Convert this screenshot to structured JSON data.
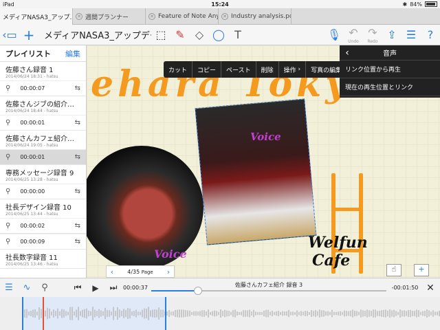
{
  "status": {
    "carrier": "iPad",
    "time": "15:24",
    "battery": "84%",
    "battery_level": 0.84
  },
  "tabs": [
    {
      "label": "メディアNASA3_アップ…",
      "active": true
    },
    {
      "label": "週間プランナー",
      "active": false
    },
    {
      "label": "Feature of Note Anyt…",
      "active": false
    },
    {
      "label": "Industry analysis.pdf",
      "active": false
    }
  ],
  "toolbar": {
    "doc_title": "メディアNASA3_アップデート…",
    "undo_label": "Undo",
    "redo_label": "Redo"
  },
  "sidebar": {
    "title": "プレイリスト",
    "edit_label": "編集",
    "items": [
      {
        "title": "佐藤さん録音 1",
        "date": "2014/06/24 18:31 - hatsu",
        "clip": "00:00:07",
        "active": false
      },
      {
        "title": "佐藤さんジブの紹介…",
        "date": "2014/06/24 18:44 - hatsu",
        "clip": "00:00:01",
        "active": false
      },
      {
        "title": "佐藤さんカフェ紹介…",
        "date": "2014/06/24 19:05 - hatsu",
        "clip": "00:00:01",
        "active": true
      },
      {
        "title": "専務メッセージ録音 9",
        "date": "2014/06/25 13:28 - hatsu",
        "clip": "00:00:00",
        "active": false
      },
      {
        "title": "社長デザイン録音 10",
        "date": "2014/06/25 13:44 - hatsu",
        "clip": "00:00:02",
        "active": false
      },
      {
        "title": "",
        "date": "",
        "clip": "00:00:09",
        "active": false
      },
      {
        "title": "社長数字録音 11",
        "date": "2014/06/25 13:46 - hatsu",
        "clip": "",
        "active": false
      }
    ]
  },
  "canvas": {
    "handwriting_top": "ehara Tokyo",
    "handwriting_voice1": "Voice",
    "handwriting_voice2": "Voice",
    "handwriting_cafe1": "Welfun",
    "handwriting_cafe2": "Cafe"
  },
  "context_menu": [
    "カット",
    "コピー",
    "ペースト",
    "削除",
    "操作",
    "写真の編集"
  ],
  "voice_panel": {
    "title": "音声",
    "items": [
      "リンク位置から再生",
      "現在の再生位置とリンク"
    ]
  },
  "pager": {
    "text": "4/35",
    "label": "Page"
  },
  "player": {
    "current_time": "00:00:37",
    "track_title": "佐藤さんカフェ紹介 録音 3",
    "remaining": "-00:01:50",
    "progress": 0.2
  },
  "colors": {
    "accent": "#2a7de1",
    "ink": "#f39a1f",
    "panel": "#222222"
  }
}
